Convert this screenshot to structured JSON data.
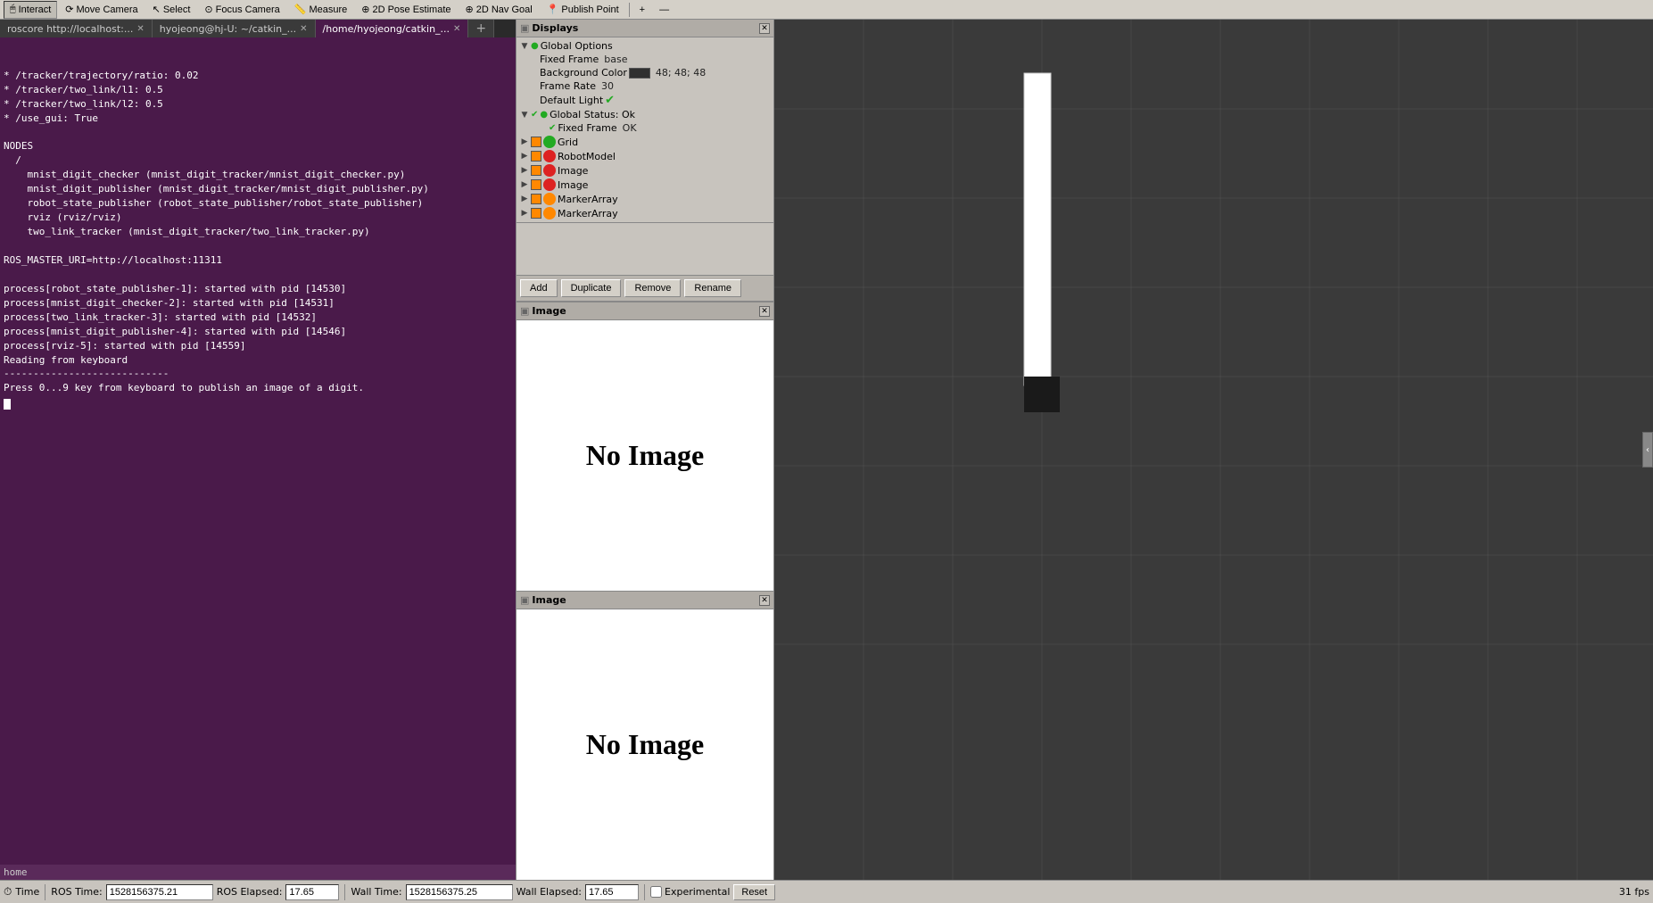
{
  "toolbar": {
    "interact_label": "Interact",
    "move_camera_label": "Move Camera",
    "select_label": "Select",
    "focus_camera_label": "Focus Camera",
    "measure_label": "Measure",
    "pose_estimate_label": "2D Pose Estimate",
    "nav_goal_label": "2D Nav Goal",
    "publish_point_label": "Publish Point"
  },
  "tabs": {
    "tab1_label": "roscore http://localhost:...",
    "tab2_label": "hyojeong@hj-U: ~/catkin_...",
    "tab3_label": "/home/hyojeong/catkin_..."
  },
  "terminal": {
    "lines": [
      "* /tracker/trajectory/ratio: 0.02",
      "* /tracker/two_link/l1: 0.5",
      "* /tracker/two_link/l2: 0.5",
      "* /use_gui: True",
      "",
      "NODES",
      "  /",
      "    mnist_digit_checker (mnist_digit_tracker/mnist_digit_checker.py)",
      "    mnist_digit_publisher (mnist_digit_tracker/mnist_digit_publisher.py)",
      "    robot_state_publisher (robot_state_publisher/robot_state_publisher)",
      "    rviz (rviz/rviz)",
      "    two_link_tracker (mnist_digit_tracker/two_link_tracker.py)",
      "",
      "ROS_MASTER_URI=http://localhost:11311",
      "",
      "process[robot_state_publisher-1]: started with pid [14530]",
      "process[mnist_digit_checker-2]: started with pid [14531]",
      "process[two_link_tracker-3]: started with pid [14532]",
      "process[mnist_digit_publisher-4]: started with pid [14546]",
      "process[rviz-5]: started with pid [14559]",
      "Reading from keyboard",
      "----------------------------",
      "Press 0...9 key from keyboard to publish an image of a digit."
    ],
    "home_label": "home"
  },
  "displays": {
    "panel_title": "Displays",
    "global_options": {
      "label": "Global Options",
      "fixed_frame_label": "Fixed Frame",
      "fixed_frame_value": "base",
      "bg_color_label": "Background Color",
      "bg_color_value": "48; 48; 48",
      "frame_rate_label": "Frame Rate",
      "frame_rate_value": "30",
      "default_light_label": "Default Light"
    },
    "global_status": {
      "label": "Global Status: Ok",
      "fixed_frame_label": "Fixed Frame",
      "fixed_frame_value": "OK"
    },
    "items": [
      {
        "name": "Grid",
        "enabled": true,
        "color": "green"
      },
      {
        "name": "RobotModel",
        "enabled": true,
        "color": "red"
      },
      {
        "name": "Image",
        "enabled": true,
        "color": "red"
      },
      {
        "name": "Image",
        "enabled": true,
        "color": "red"
      },
      {
        "name": "MarkerArray",
        "enabled": true,
        "color": "orange"
      },
      {
        "name": "MarkerArray",
        "enabled": true,
        "color": "orange"
      }
    ],
    "buttons": {
      "add": "Add",
      "duplicate": "Duplicate",
      "remove": "Remove",
      "rename": "Rename"
    }
  },
  "image_panels": [
    {
      "title": "Image",
      "content": "No Image"
    },
    {
      "title": "Image",
      "content": "No Image"
    }
  ],
  "status_bar": {
    "time_label": "Time",
    "ros_time_label": "ROS Time:",
    "ros_time_value": "1528156375.21",
    "ros_elapsed_label": "ROS Elapsed:",
    "ros_elapsed_value": "17.65",
    "wall_time_label": "Wall Time:",
    "wall_time_value": "1528156375.25",
    "wall_elapsed_label": "Wall Elapsed:",
    "wall_elapsed_value": "17.65",
    "experimental_label": "Experimental",
    "fps_value": "31 fps",
    "reset_label": "Reset"
  }
}
